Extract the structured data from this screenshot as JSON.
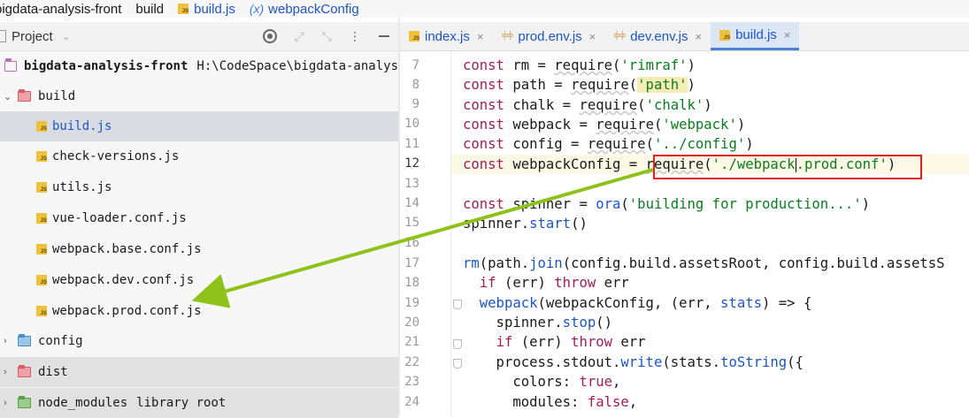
{
  "breadcrumb": {
    "project": "bigdata-analysis-front",
    "folder": "build",
    "file": "build.js",
    "var_icon": "(x)",
    "symbol": "webpackConfig"
  },
  "project_panel": {
    "title": "Project",
    "tools": [
      "locate-icon",
      "expand-icon",
      "collapse-icon",
      "options-icon",
      "hide-icon"
    ]
  },
  "tree": {
    "root": {
      "name": "bigdata-analysis-front",
      "path": "H:\\CodeSpace\\bigdata-analys"
    },
    "build_folder": "build",
    "build_files": [
      "build.js",
      "check-versions.js",
      "utils.js",
      "vue-loader.conf.js",
      "webpack.base.conf.js",
      "webpack.dev.conf.js",
      "webpack.prod.conf.js"
    ],
    "config_folder": "config",
    "dist_folder": "dist",
    "node_modules": {
      "name": "node_modules",
      "tag": "library root"
    }
  },
  "tabs": [
    {
      "label": "index.js",
      "icon": "js-file-icon",
      "active": false
    },
    {
      "label": "prod.env.js",
      "icon": "config-file-icon",
      "active": false
    },
    {
      "label": "dev.env.js",
      "icon": "config-file-icon",
      "active": false
    },
    {
      "label": "build.js",
      "icon": "js-file-icon",
      "active": true
    }
  ],
  "tab_close_glyph": "×",
  "editor": {
    "current_line": 12,
    "line_numbers": [
      7,
      8,
      9,
      10,
      11,
      12,
      13,
      14,
      15,
      16,
      17,
      18,
      19,
      20,
      21,
      22,
      23,
      24
    ],
    "code": {
      "l7": {
        "a": "const",
        "b": " rm = ",
        "c": "require",
        "d": "(",
        "e": "'rimraf'",
        "f": ")"
      },
      "l8": {
        "a": "const",
        "b": " path = ",
        "c": "require",
        "d": "(",
        "e": "'path'",
        "f": ")"
      },
      "l9": {
        "a": "const",
        "b": " chalk = ",
        "c": "require",
        "d": "(",
        "e": "'chalk'",
        "f": ")"
      },
      "l10": {
        "a": "const",
        "b": " webpack = ",
        "c": "require",
        "d": "(",
        "e": "'webpack'",
        "f": ")"
      },
      "l11": {
        "a": "const",
        "b": " config = ",
        "c": "require",
        "d": "(",
        "e": "'../config'",
        "f": ")"
      },
      "l12": {
        "a": "const",
        "b": " webpackConfig = ",
        "c": "require",
        "d": "(",
        "e1": "'./webpack",
        "e2": ".prod.conf'",
        "f": ")"
      },
      "l14": {
        "a": "const",
        "b": " spinner = ",
        "c": "ora",
        "d": "(",
        "e": "'building for production...'",
        "f": ")"
      },
      "l15": {
        "a": "spinner",
        "b": ".",
        "c": "start",
        "d": "()"
      },
      "l17": {
        "a": "rm",
        "b": "(path.",
        "c": "join",
        "d": "(config.build.assetsRoot, config.build.assetsS"
      },
      "l18": {
        "a": "  ",
        "b": "if",
        "c": " (err) ",
        "d": "throw",
        "e": " err"
      },
      "l19": {
        "a": "  ",
        "b": "webpack",
        "c": "(webpackConfig, (err, ",
        "d": "stats",
        "e": ") => {"
      },
      "l20": {
        "a": "    spinner.",
        "b": "stop",
        "c": "()"
      },
      "l21": {
        "a": "    ",
        "b": "if",
        "c": " (err) ",
        "d": "throw",
        "e": " err"
      },
      "l22": {
        "a": "    process.stdout.",
        "b": "write",
        "c": "(stats.",
        "d": "toString",
        "e": "({"
      },
      "l23": {
        "a": "      colors: ",
        "b": "true",
        "c": ","
      },
      "l24": {
        "a": "      modules: ",
        "b": "false",
        "c": ","
      }
    }
  },
  "colors": {
    "keyword": "#a21b5a",
    "string": "#0a7d1f",
    "function": "#1b55c9",
    "annotation_box": "#e02020",
    "annotation_arrow": "#8ec21a"
  }
}
